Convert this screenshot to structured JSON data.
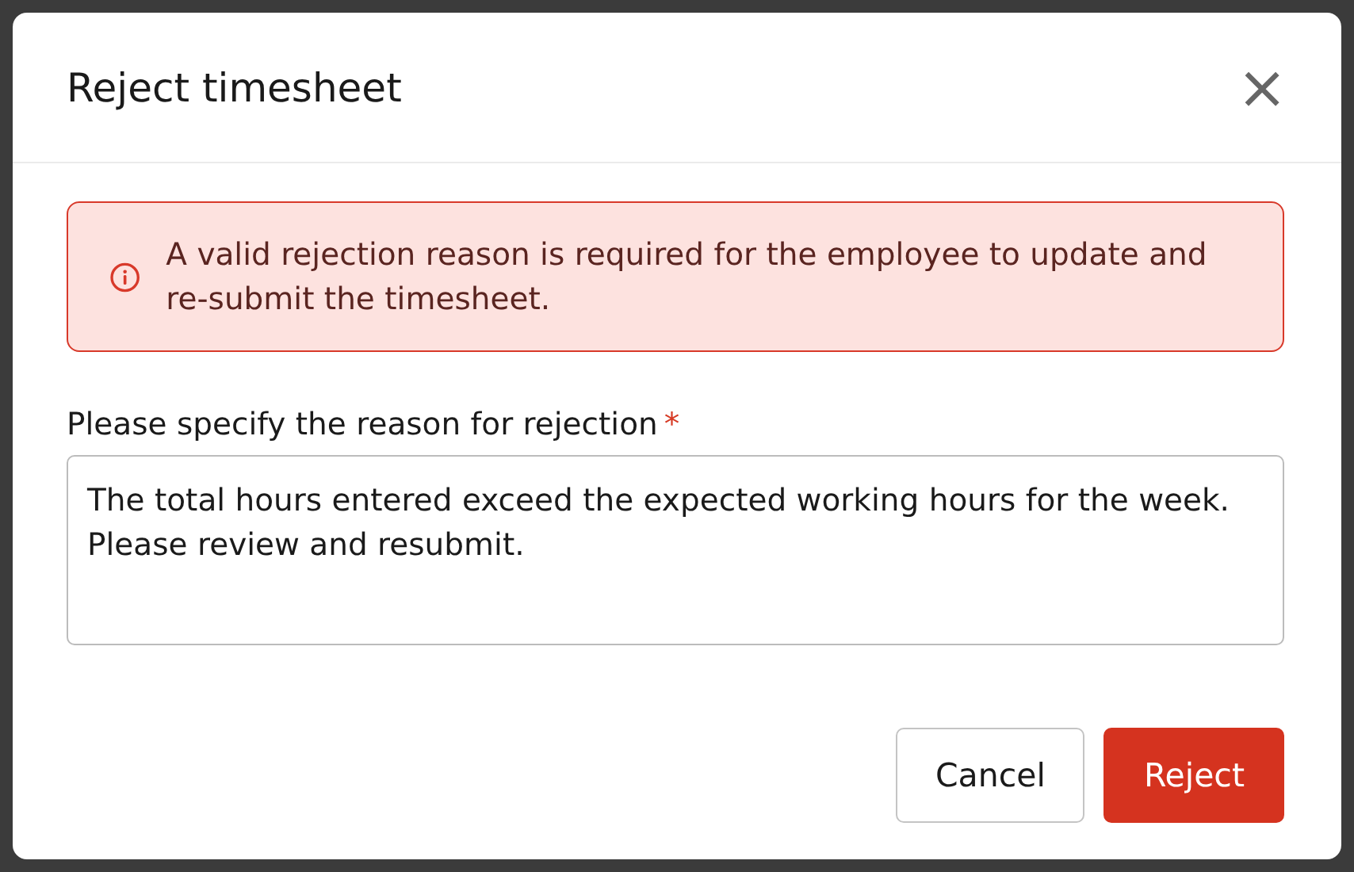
{
  "dialog": {
    "title": "Reject timesheet",
    "close": "×"
  },
  "alert": {
    "kind": "error",
    "message": "A valid rejection reason is required for the employee to update and re-submit the timesheet."
  },
  "reason_field": {
    "label": "Please specify the reason for rejection",
    "required": true,
    "required_mark": "*",
    "value": "The total hours entered exceed the expected working hours for the week. Please review and resubmit."
  },
  "buttons": [
    {
      "label": "Cancel",
      "kind": "secondary"
    },
    {
      "label": "Reject",
      "kind": "primary"
    }
  ]
}
